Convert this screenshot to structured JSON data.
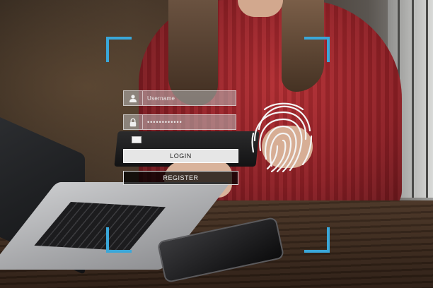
{
  "login_form": {
    "username_placeholder": "Username",
    "password_mask": "••••••••••••",
    "login_button": "LOGIN",
    "register_button": "REGISTER"
  },
  "icons": {
    "username": "user-icon",
    "password": "lock-icon",
    "fingerprint": "fingerprint-icon"
  },
  "colors": {
    "hud_accent": "#3aa7d9",
    "sweater": "#a8282e"
  }
}
